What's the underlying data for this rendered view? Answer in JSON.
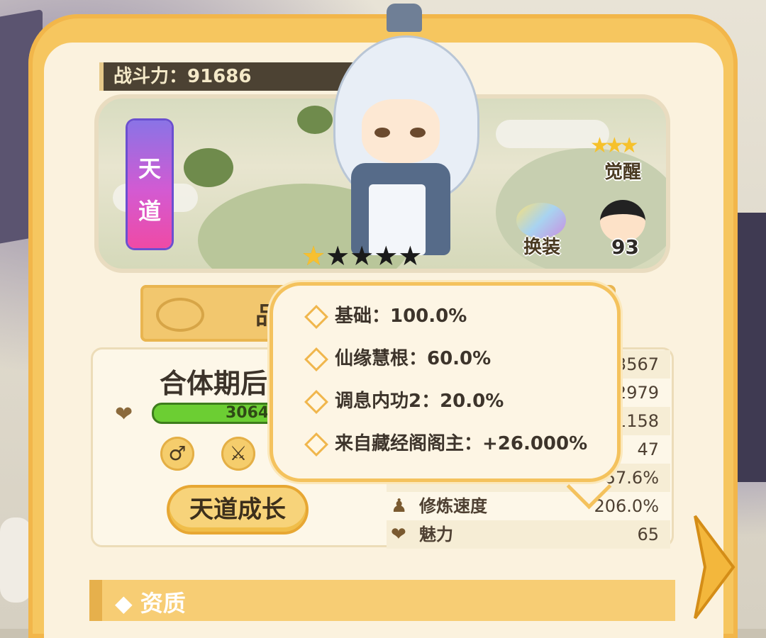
{
  "power": {
    "label": "战斗力：91686"
  },
  "tier_tag": [
    "天",
    "道"
  ],
  "stars": {
    "lit": 1,
    "total": 5
  },
  "awaken": {
    "label": "觉醒"
  },
  "change_outfit": {
    "label": "换装"
  },
  "npc": {
    "count": "93"
  },
  "ribbon": {
    "text": "品"
  },
  "realm": {
    "text": "合体期后"
  },
  "hp": {
    "text": "3064"
  },
  "grow_button": {
    "label": "天道成长"
  },
  "stats": [
    {
      "name": "",
      "value": "3567"
    },
    {
      "name": "",
      "value": "2979"
    },
    {
      "name": "",
      "value": "1158"
    },
    {
      "name": "",
      "value": "47"
    },
    {
      "name": "",
      "value": "157.6%"
    },
    {
      "name": "修炼速度",
      "value": "206.0%"
    },
    {
      "name": "魅力",
      "value": "65"
    }
  ],
  "tooltip": [
    "基础：100.0%",
    "仙缘慧根：60.0%",
    "调息内功2：20.0%",
    "来自藏经阁阁主：+26.000%"
  ],
  "section": {
    "label": "◆ 资质"
  },
  "icons": {
    "male": "♂",
    "weapon": "⚔",
    "heart": "❤",
    "meditate": "♟"
  },
  "colors": {
    "panel": "#f6c65f",
    "tag_top": "#8a73e6",
    "tag_bottom": "#ef4aa5",
    "hp_bar": "#6cce33",
    "star_lit": "#f7c030"
  }
}
